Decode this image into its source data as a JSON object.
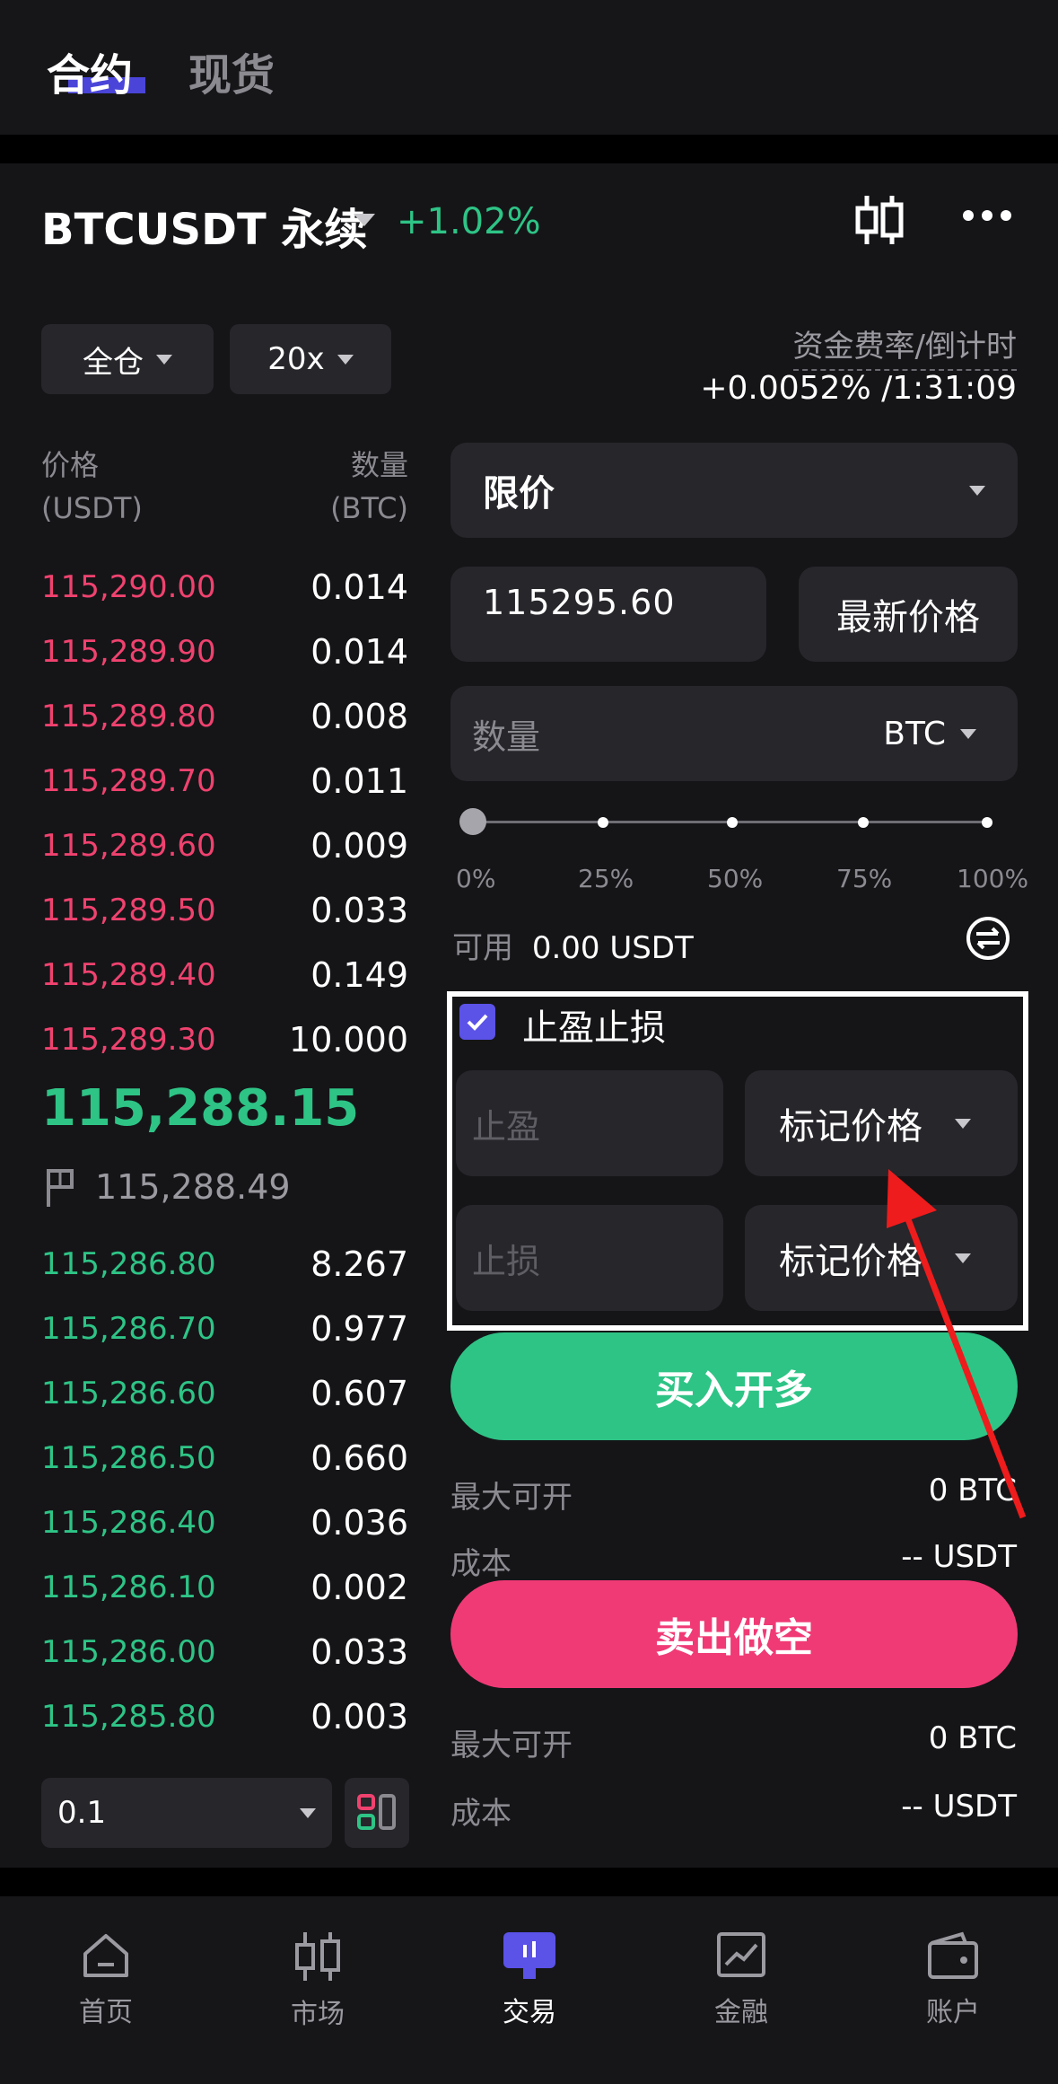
{
  "header": {
    "tabs": [
      {
        "label": "合约",
        "active": true
      },
      {
        "label": "现货",
        "active": false
      }
    ]
  },
  "instrument": {
    "symbol": "BTCUSDT 永续",
    "change": "+1.02%",
    "change_color": "#2ec486"
  },
  "controls": {
    "margin_mode": "全仓",
    "leverage": "20x"
  },
  "funding": {
    "label": "资金费率/倒计时",
    "value": "+0.0052% /1:31:09"
  },
  "orderbook": {
    "price_header": [
      "价格",
      "(USDT)"
    ],
    "qty_header": [
      "数量",
      "(BTC)"
    ],
    "asks": [
      {
        "price": "115,290.00",
        "qty": "0.014"
      },
      {
        "price": "115,289.90",
        "qty": "0.014"
      },
      {
        "price": "115,289.80",
        "qty": "0.008"
      },
      {
        "price": "115,289.70",
        "qty": "0.011"
      },
      {
        "price": "115,289.60",
        "qty": "0.009"
      },
      {
        "price": "115,289.50",
        "qty": "0.033"
      },
      {
        "price": "115,289.40",
        "qty": "0.149"
      },
      {
        "price": "115,289.30",
        "qty": "10.000"
      }
    ],
    "last_price": "115,288.15",
    "mark_price": "115,288.49",
    "bids": [
      {
        "price": "115,286.80",
        "qty": "8.267"
      },
      {
        "price": "115,286.70",
        "qty": "0.977"
      },
      {
        "price": "115,286.60",
        "qty": "0.607"
      },
      {
        "price": "115,286.50",
        "qty": "0.660"
      },
      {
        "price": "115,286.40",
        "qty": "0.036"
      },
      {
        "price": "115,286.10",
        "qty": "0.002"
      },
      {
        "price": "115,286.00",
        "qty": "0.033"
      },
      {
        "price": "115,285.80",
        "qty": "0.003"
      }
    ],
    "depth_step": "0.1"
  },
  "order_form": {
    "order_type": "限价",
    "price_value": "115295.60",
    "latest_price_button": "最新价格",
    "quantity_placeholder": "数量",
    "quantity_unit": "BTC",
    "slider_marks": [
      "0%",
      "25%",
      "50%",
      "75%",
      "100%"
    ],
    "slider_value": 0,
    "available_label": "可用",
    "available_value": "0.00 USDT",
    "tpsl_label": "止盈止损",
    "tpsl_checked": true,
    "tp_placeholder": "止盈",
    "sl_placeholder": "止损",
    "tp_trigger": "标记价格",
    "sl_trigger": "标记价格",
    "buy_button": "买入开多",
    "sell_button": "卖出做空",
    "buy_info": {
      "max_label": "最大可开",
      "max_value": "0 BTC",
      "cost_label": "成本",
      "cost_value": "-- USDT"
    },
    "sell_info": {
      "max_label": "最大可开",
      "max_value": "0 BTC",
      "cost_label": "成本",
      "cost_value": "-- USDT"
    }
  },
  "nav": [
    {
      "label": "首页",
      "icon": "home-icon"
    },
    {
      "label": "市场",
      "icon": "candlestick-icon"
    },
    {
      "label": "交易",
      "icon": "trade-icon",
      "active": true
    },
    {
      "label": "金融",
      "icon": "chart-icon"
    },
    {
      "label": "账户",
      "icon": "wallet-icon"
    }
  ],
  "colors": {
    "ask": "#f0426f",
    "bid": "#2ec486",
    "accent": "#4a45d8",
    "sell": "#f03a76"
  }
}
